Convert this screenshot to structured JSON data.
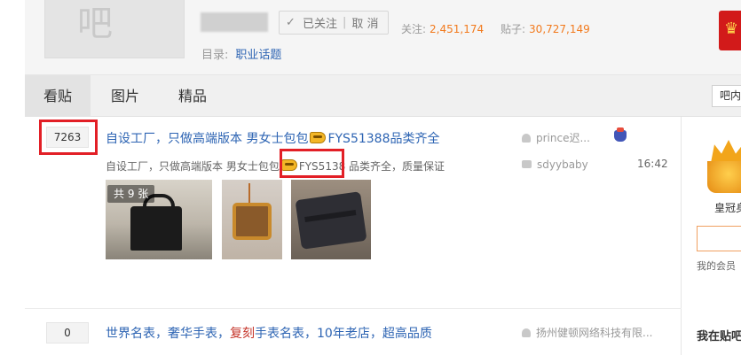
{
  "header": {
    "avatar_glyph": "吧",
    "follow_label": "已关注",
    "cancel_label": "取 消",
    "follow_count_label": "关注:",
    "follow_count": "2,451,174",
    "post_count_label": "贴子:",
    "post_count": "30,727,149",
    "catalog_label": "目录:",
    "catalog_link": "职业话题"
  },
  "tabs": [
    {
      "label": "看贴",
      "active": true
    },
    {
      "label": "图片",
      "active": false
    },
    {
      "label": "精品",
      "active": false
    }
  ],
  "forum_search": {
    "label": "吧内"
  },
  "threads": [
    {
      "reply_count": "7263",
      "title_before": "自设工厂，只做高端版本 男女士包包",
      "title_after": "FYS51388品类齐全",
      "abstract_before": "自设工厂，只做高端版本 男女士包包",
      "abstract_code": "FYS5138",
      "abstract_after": " 品类齐全，质量保证",
      "author": "prince迟...",
      "last_replier": "sdyybaby",
      "time": "16:42",
      "image_count": "共 9 张"
    },
    {
      "reply_count": "0",
      "title_before": "世界名表，奢华手表，",
      "title_highlight": "复刻",
      "title_after": "手表名表，10年老店，超高品质",
      "author": "扬州健顿网络科技有限..."
    }
  ],
  "sidebar": {
    "crown_label": "皇冠身",
    "member_note": "我的会员",
    "heading": "我在贴吧"
  },
  "colors": {
    "link": "#2d64b3",
    "stat_number": "#f27a1d",
    "annotation_box": "#e21f26"
  }
}
